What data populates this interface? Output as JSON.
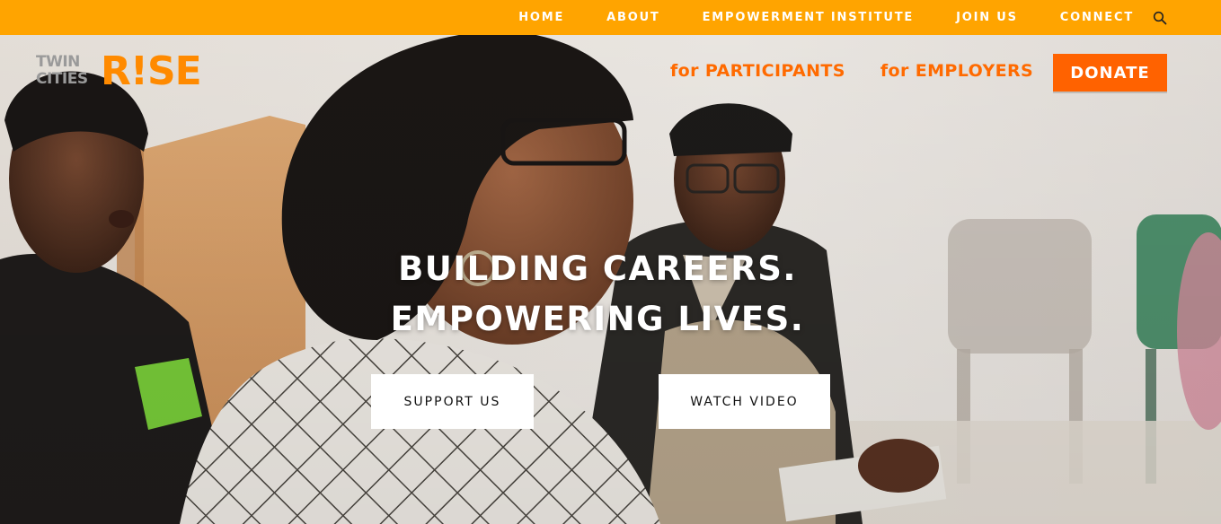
{
  "topbar": {
    "items": [
      {
        "label": "HOME"
      },
      {
        "label": "ABOUT"
      },
      {
        "label": "EMPOWERMENT INSTITUTE"
      },
      {
        "label": "JOIN US"
      },
      {
        "label": "CONNECT"
      }
    ],
    "search_icon": "search-icon"
  },
  "logo": {
    "twin": "TWIN",
    "cities": "CITIES",
    "rise": "R!SE"
  },
  "mainnav": {
    "participants": "for PARTICIPANTS",
    "employers": "for EMPLOYERS",
    "donate": "DONATE"
  },
  "hero": {
    "line1": "BUILDING CAREERS.",
    "line2": "EMPOWERING LIVES.",
    "support_label": "SUPPORT US",
    "video_label": "WATCH VIDEO"
  },
  "colors": {
    "topbar": "#ffa400",
    "nav_link": "#ff6a00",
    "donate_bg": "#ff6200",
    "logo_rise": "#ff8a00",
    "logo_gray": "#9a9a9a"
  }
}
